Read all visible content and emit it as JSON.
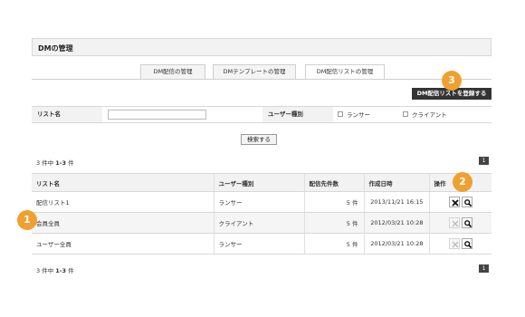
{
  "page": {
    "title": "DMの管理"
  },
  "tabs": [
    {
      "label": "DM配信の管理"
    },
    {
      "label": "DMテンプレートの管理"
    },
    {
      "label": "DM配信リストの管理"
    }
  ],
  "register_button": {
    "label": "DM配信リストを登録する"
  },
  "search": {
    "list_name_label": "リスト名",
    "list_name_value": "",
    "user_type_label": "ユーザー種別",
    "options": [
      {
        "label": "ランサー"
      },
      {
        "label": "クライアント"
      }
    ],
    "submit_label": "検索する"
  },
  "results": {
    "count_text": "3 件中",
    "range_text": "1-3",
    "unit_text": "件",
    "page": "1"
  },
  "table": {
    "headers": {
      "list_name": "リスト名",
      "user_type": "ユーザー種別",
      "recipients": "配信先件数",
      "created": "作成日時",
      "ops": "操作"
    },
    "rows": [
      {
        "name": "配信リスト1",
        "type": "ランサー",
        "count": "5 件",
        "date": "2013/11/21 16:15"
      },
      {
        "name": "会員全員",
        "type": "クライアント",
        "count": "5 件",
        "date": "2012/03/21 10:28"
      },
      {
        "name": "ユーザー全員",
        "type": "ランサー",
        "count": "5 件",
        "date": "2012/03/21 10:28"
      }
    ]
  },
  "callouts": [
    {
      "label": "1"
    },
    {
      "label": "2"
    },
    {
      "label": "3"
    }
  ],
  "colors": {
    "badge": "#f0a030",
    "dark_button": "#333333",
    "header_bg": "#f2f2f2"
  },
  "icons": {
    "delete": "close-icon",
    "view": "magnifier-icon"
  }
}
